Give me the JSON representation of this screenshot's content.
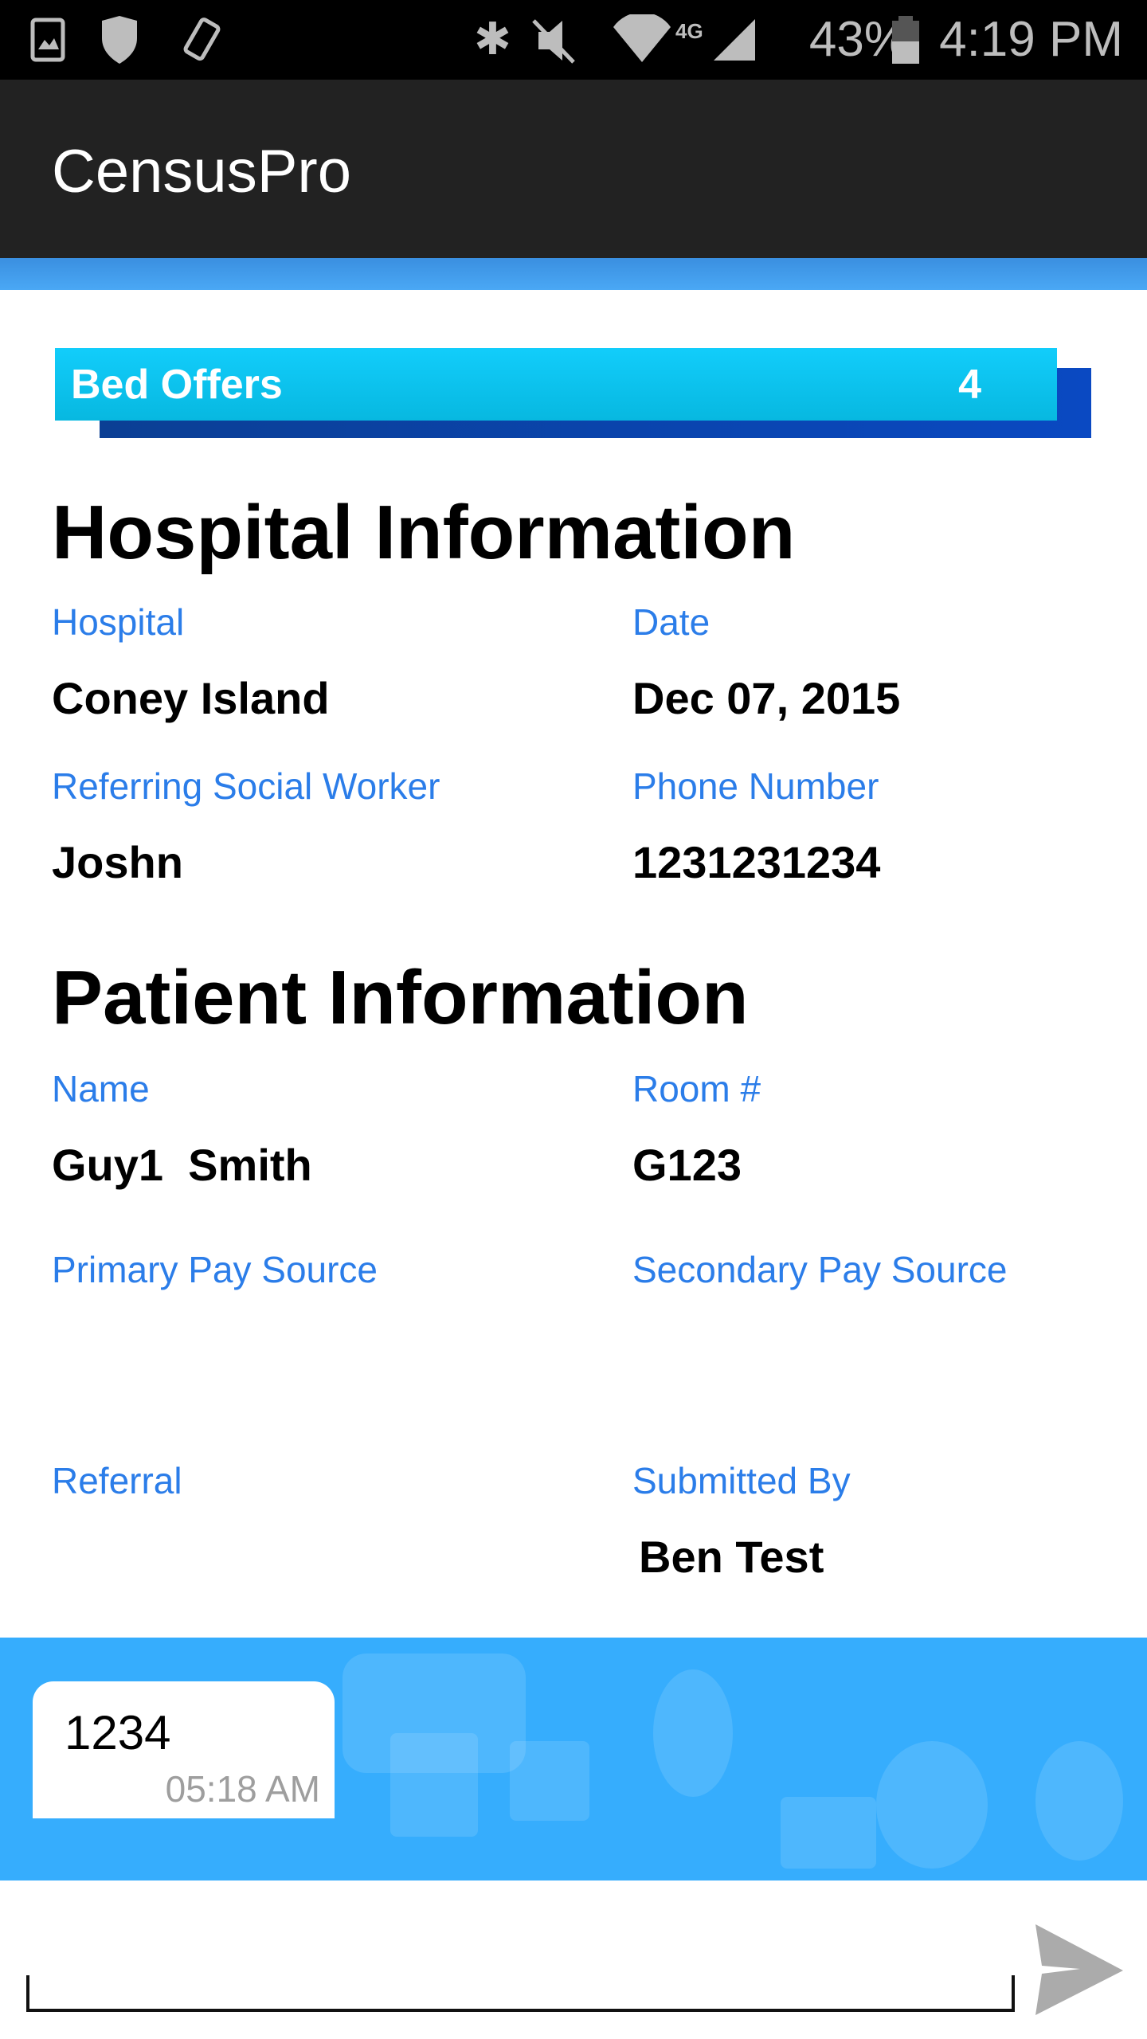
{
  "status_bar": {
    "battery": "43%",
    "time": "4:19 PM",
    "icons": [
      "gallery-icon",
      "shield-sync-icon",
      "phone-rotate-icon",
      "bluetooth-icon",
      "vibrate-mute-icon",
      "wifi-icon",
      "4g-lte-icon",
      "signal-icon",
      "battery-icon"
    ]
  },
  "app_bar": {
    "title": "CensusPro"
  },
  "bed_offers": {
    "label": "Bed Offers",
    "count": "4"
  },
  "hospital_info": {
    "heading": "Hospital Information",
    "hospital_label": "Hospital",
    "hospital_value": "Coney Island",
    "date_label": "Date",
    "date_value": "Dec 07, 2015",
    "social_worker_label": "Referring Social Worker",
    "social_worker_value": "Joshn",
    "phone_label": "Phone Number",
    "phone_value": "1231231234"
  },
  "patient_info": {
    "heading": "Patient Information",
    "name_label": "Name",
    "name_value": "Guy1  Smith",
    "room_label": "Room #",
    "room_value": "G123",
    "primary_pay_label": "Primary Pay Source",
    "secondary_pay_label": "Secondary Pay Source",
    "referral_label": "Referral",
    "submitted_by_label": "Submitted By",
    "submitted_by_value": "Ben Test"
  },
  "chat": {
    "messages": [
      {
        "text": "1234",
        "time": "05:18 AM"
      }
    ],
    "input_value": "",
    "send_icon": "send-icon"
  },
  "colors": {
    "accent_label": "#2b7de9",
    "banner": "#12cdfb",
    "chat_bg": "#36adfd",
    "app_bar": "#222222"
  }
}
